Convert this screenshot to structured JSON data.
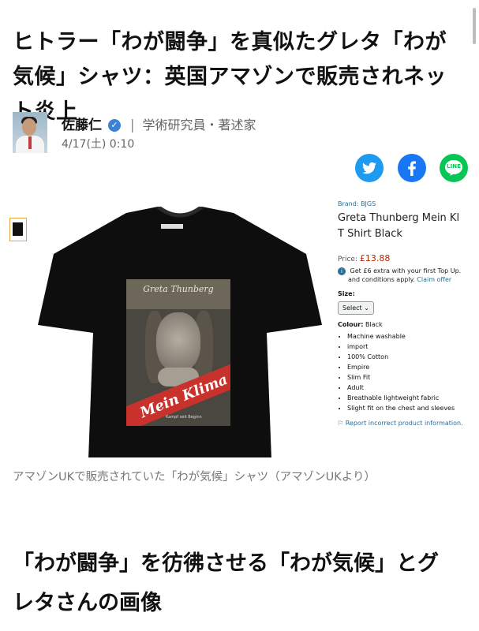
{
  "article": {
    "headline": "ヒトラー「わが闘争」を真似たグレタ「わが気候」シャツ：英国アマゾンで販売されネット炎上",
    "author": {
      "name": "佐藤仁",
      "separator": "|",
      "title": "学術研究員・著述家",
      "date": "4/17(土) 0:10"
    },
    "share": {
      "twitter_icon": "twitter-bird-icon",
      "facebook_icon": "facebook-f-icon",
      "line_label": "LINE"
    },
    "image": {
      "poster_name": "Greta Thunberg",
      "poster_script": "Mein Klima",
      "poster_sub": "Kampf seit Beginn",
      "product": {
        "brand": "Brand: BJGS",
        "title_line1": "Greta Thunberg Mein Kl",
        "title_line2": "T Shirt Black",
        "price_label": "Price:",
        "price": "£13.88",
        "offer_line1": "Get £6 extra with your first Top Up.",
        "offer_line2": "and conditions apply.",
        "offer_link": "Claim offer",
        "size_label": "Size:",
        "size_value": "Select",
        "colour_label": "Colour:",
        "colour_value": "Black",
        "features": [
          "Machine washable",
          "import",
          "100% Cotton",
          "Empire",
          "Slim Fit",
          "Adult",
          "Breathable lightweight fabric",
          "Slight fit on the chest and sleeves"
        ],
        "report": "Report incorrect product information."
      }
    },
    "caption": "アマゾンUKで販売されていた「わが気候」シャツ（アマゾンUKより）",
    "subhead": "「わが闘争」を彷彿させる「わが気候」とグレタさんの画像"
  },
  "colors": {
    "twitter": "#1d9bf0",
    "facebook": "#1877f2",
    "line": "#06c755",
    "link": "#2a6f97",
    "price": "#b12704"
  }
}
